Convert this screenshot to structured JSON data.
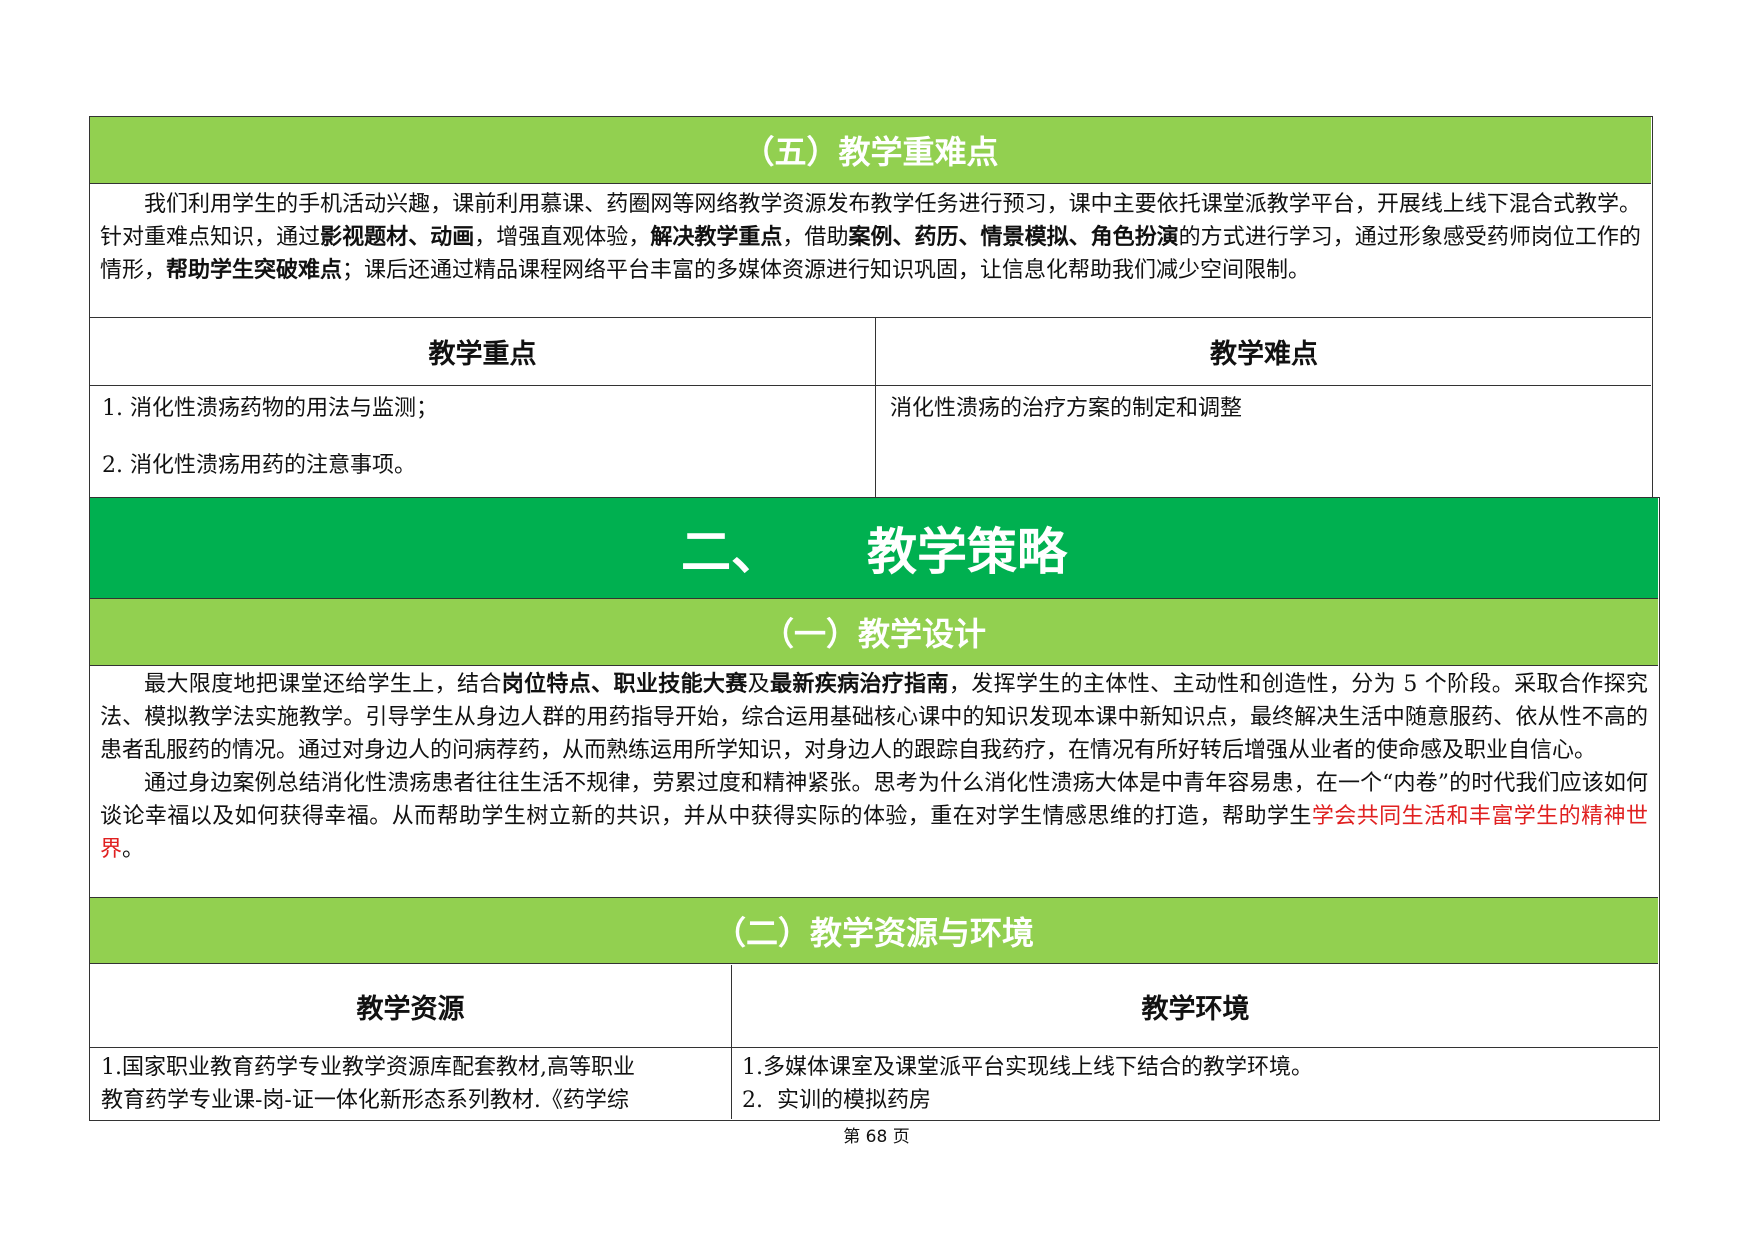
{
  "section5": {
    "title": "（五）教学重难点",
    "intro_parts": [
      {
        "t": "我们利用学生的手机活动兴趣，课前利用慕课、药圈网等网络教学资源发布教学任务进行预习，课中主要依托课堂派教学平台，开展线上线下混合式教学。针对重难点知识，通过",
        "s": "n"
      },
      {
        "t": "影视题材、动画",
        "s": "b"
      },
      {
        "t": "，增强直观体验，",
        "s": "n"
      },
      {
        "t": "解决教学重点",
        "s": "b"
      },
      {
        "t": "，借助",
        "s": "n"
      },
      {
        "t": "案例、药历、情景模拟、角色扮演",
        "s": "b"
      },
      {
        "t": "的方式进行学习，通过形象感受药师岗位工作的情形，",
        "s": "n"
      },
      {
        "t": "帮助学生突破难点",
        "s": "b"
      },
      {
        "t": "；课后还通过精品课程网络平台丰富的多媒体资源进行知识巩固，让信息化帮助我们减少空间限制。",
        "s": "n"
      }
    ],
    "key_header": "教学重点",
    "difficulty_header": "教学难点",
    "key_items": [
      "1. 消化性溃疡药物的用法与监测；",
      "2. 消化性溃疡用药的注意事项。"
    ],
    "difficulty_text": "消化性溃疡的治疗方案的制定和调整"
  },
  "chapter2": {
    "number": "二、",
    "title": "教学策略"
  },
  "section1": {
    "title": "（一）教学设计",
    "para1_parts": [
      {
        "t": "最大限度地把课堂还给学生上，结合",
        "s": "n"
      },
      {
        "t": "岗位特点、职业技能大赛",
        "s": "b"
      },
      {
        "t": "及",
        "s": "n"
      },
      {
        "t": "最新疾病治疗指南",
        "s": "b"
      },
      {
        "t": "，发挥学生的主体性、主动性和创造性，分为 5 个阶段。采取合作探究法、模拟教学法实施教学。引导学生从身边人群的用药指导开始，综合运用基础核心课中的知识发现本课中新知识点，最终解决生活中随意服药、依从性不高的患者乱服药的情况。通过对身边人的问病荐药，从而熟练运用所学知识，对身边人的跟踪自我药疗，在情况有所好转后增强从业者的使命感及职业自信心。",
        "s": "n"
      }
    ],
    "para2_parts": [
      {
        "t": "通过身边案例总结消化性溃疡患者往往生活不规律，劳累过度和精神紧张。思考为什么消化性溃疡大体是中青年容易患，在一个“内卷”的时代我们应该如何谈论幸福以及如何获得幸福。从而帮助学生树立新的共识，并从中获得实际的体验，重在对学生情感思维的打造，帮助学生",
        "s": "n"
      },
      {
        "t": "学会共同生活和丰富学生的精神世界",
        "s": "r"
      },
      {
        "t": "。",
        "s": "n"
      }
    ]
  },
  "section2": {
    "title": "（二）教学资源与环境",
    "resource_header": "教学资源",
    "environment_header": "教学环境",
    "resource_lines": [
      "1.国家职业教育药学专业教学资源库配套教材,高等职业",
      "教育药学专业课-岗-证一体化新形态系列教材.《药学综"
    ],
    "environment_lines": [
      "1.多媒体课室及课堂派平台实现线上线下结合的教学环境。",
      "2.  实训的模拟药房"
    ]
  },
  "footer": {
    "prefix": "第",
    "page": "68",
    "suffix": "页"
  },
  "colors": {
    "light_green": "#92d050",
    "dark_green": "#00b050",
    "red_text": "#e02020"
  }
}
